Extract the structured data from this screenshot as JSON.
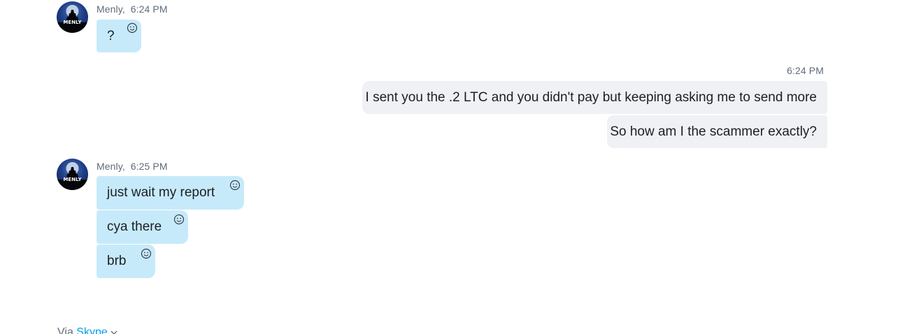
{
  "groups": [
    {
      "sender": "Menly",
      "time": "6:24 PM",
      "avatar_text": "MENLY",
      "messages": [
        "?"
      ]
    },
    {
      "time": "6:24 PM",
      "messages": [
        "I sent you the .2 LTC and you didn't pay but keeping asking me to send more",
        "So how am I the scammer exactly?"
      ]
    },
    {
      "sender": "Menly",
      "time": "6:25 PM",
      "avatar_text": "MENLY",
      "messages": [
        "just wait my report",
        "cya there",
        "brb"
      ]
    }
  ],
  "footer": {
    "via_label": "Via",
    "via_link": "Skype",
    "chevron": "chevron-down-icon"
  },
  "colors": {
    "incoming_bubble": "#c7eafb",
    "outgoing_bubble": "#eff1f5",
    "meta_text": "#5f6b7a",
    "link": "#00a2e3"
  },
  "icons": {
    "reaction": "smiley-icon"
  }
}
